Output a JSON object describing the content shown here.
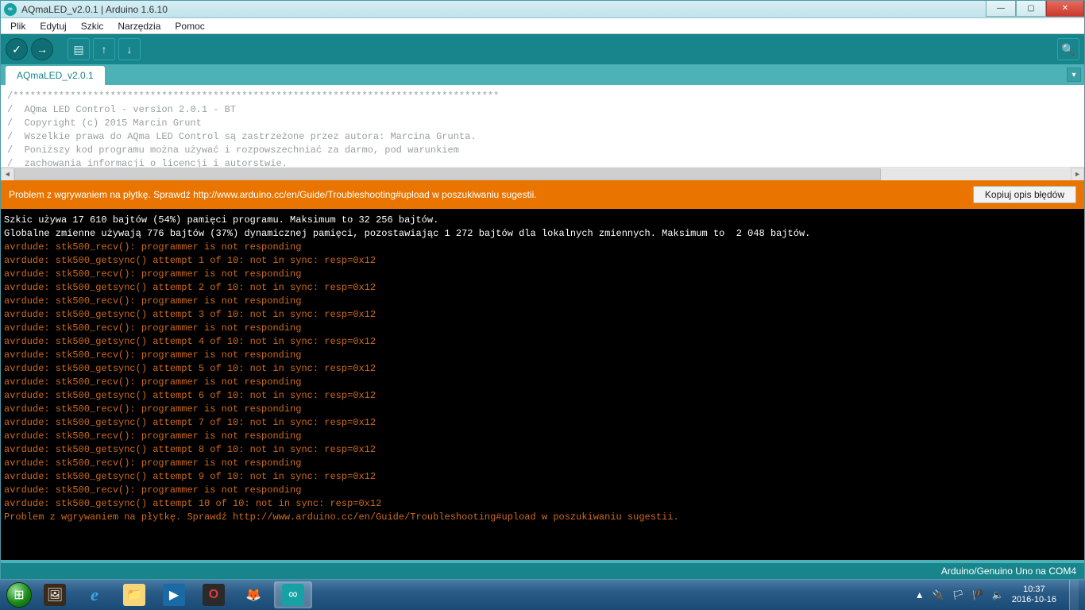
{
  "titlebar": {
    "title": "AQmaLED_v2.0.1 | Arduino 1.6.10",
    "app_icon_glyph": "∞"
  },
  "menu": {
    "items": [
      "Plik",
      "Edytuj",
      "Szkic",
      "Narzędzia",
      "Pomoc"
    ]
  },
  "toolbar": {
    "verify_glyph": "✓",
    "upload_glyph": "→",
    "new_glyph": "▤",
    "open_glyph": "↑",
    "save_glyph": "↓",
    "serial_glyph": "🔍"
  },
  "tabs": {
    "active": "AQmaLED_v2.0.1",
    "drop_glyph": "▾"
  },
  "code_lines": [
    "/*************************************************************************************",
    "/  AQma LED Control - version 2.0.1 - BT",
    "/  Copyright (c) 2015 Marcin Grunt",
    "/  Wszelkie prawa do AQma LED Control są zastrzeżone przez autora: Marcina Grunta.",
    "/  Poniższy kod programu można używać i rozpowszechniać za darmo, pod warunkiem",
    "/  zachowania informacji o licencji i autorstwie."
  ],
  "errorbar": {
    "message": "Problem z wgrywaniem na płytkę. Sprawdź http://www.arduino.cc/en/Guide/Troubleshooting#upload w poszukiwaniu sugestii.",
    "copy_label": "Kopiuj opis błędów"
  },
  "console_white": [
    "",
    "Szkic używa 17 610 bajtów (54%) pamięci programu. Maksimum to 32 256 bajtów.",
    "Globalne zmienne używają 776 bajtów (37%) dynamicznej pamięci, pozostawiając 1 272 bajtów dla lokalnych zmiennych. Maksimum to  2 048 bajtów."
  ],
  "console_orange": [
    "avrdude: stk500_recv(): programmer is not responding",
    "avrdude: stk500_getsync() attempt 1 of 10: not in sync: resp=0x12",
    "avrdude: stk500_recv(): programmer is not responding",
    "avrdude: stk500_getsync() attempt 2 of 10: not in sync: resp=0x12",
    "avrdude: stk500_recv(): programmer is not responding",
    "avrdude: stk500_getsync() attempt 3 of 10: not in sync: resp=0x12",
    "avrdude: stk500_recv(): programmer is not responding",
    "avrdude: stk500_getsync() attempt 4 of 10: not in sync: resp=0x12",
    "avrdude: stk500_recv(): programmer is not responding",
    "avrdude: stk500_getsync() attempt 5 of 10: not in sync: resp=0x12",
    "avrdude: stk500_recv(): programmer is not responding",
    "avrdude: stk500_getsync() attempt 6 of 10: not in sync: resp=0x12",
    "avrdude: stk500_recv(): programmer is not responding",
    "avrdude: stk500_getsync() attempt 7 of 10: not in sync: resp=0x12",
    "avrdude: stk500_recv(): programmer is not responding",
    "avrdude: stk500_getsync() attempt 8 of 10: not in sync: resp=0x12",
    "avrdude: stk500_recv(): programmer is not responding",
    "avrdude: stk500_getsync() attempt 9 of 10: not in sync: resp=0x12",
    "avrdude: stk500_recv(): programmer is not responding",
    "avrdude: stk500_getsync() attempt 10 of 10: not in sync: resp=0x12",
    "Problem z wgrywaniem na płytkę. Sprawdź http://www.arduino.cc/en/Guide/Troubleshooting#upload w poszukiwaniu sugestii."
  ],
  "statusbar": {
    "board": "Arduino/Genuino Uno na COM4"
  },
  "taskbar": {
    "pins": [
      {
        "name": "app-unknown",
        "bg": "#3a2a1a",
        "glyph": "🖼"
      },
      {
        "name": "internet-explorer",
        "bg": "transparent",
        "glyph": "e",
        "style": "color:#3ba7e0;font-style:italic;font-weight:bold;font-size:22px;font-family:Georgia,serif;"
      },
      {
        "name": "file-explorer",
        "bg": "#f6d67a",
        "glyph": "📁"
      },
      {
        "name": "media-player",
        "bg": "#1a6aa6",
        "glyph": "▶"
      },
      {
        "name": "opera",
        "bg": "#2a2a2a",
        "glyph": "O",
        "style": "color:#e03a3a;font-weight:bold;"
      },
      {
        "name": "firefox",
        "bg": "transparent",
        "glyph": "🦊"
      },
      {
        "name": "arduino-ide",
        "bg": "#17a1a5",
        "glyph": "∞",
        "active": true
      }
    ],
    "tray_icons": [
      "▲",
      "🔌",
      "🏳",
      "🏴",
      "🔈"
    ],
    "time": "10:37",
    "date": "2016-10-16"
  }
}
